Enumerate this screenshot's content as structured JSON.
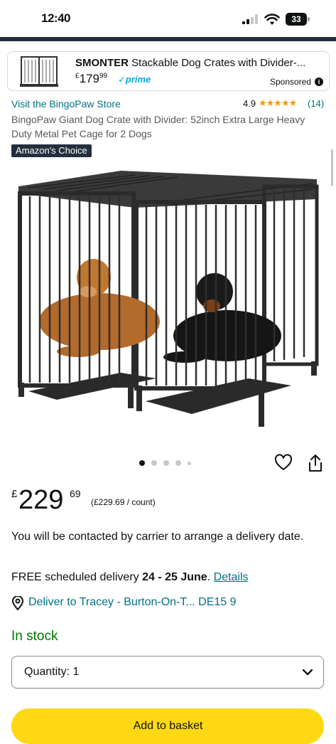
{
  "status_bar": {
    "time": "12:40",
    "battery": "33"
  },
  "sponsored": {
    "brand": "SMONTER",
    "title": " Stackable Dog Crates with Divider-...",
    "price_currency": "£",
    "price_whole": "179",
    "price_fraction": "99",
    "prime": "✓prime",
    "label": "Sponsored"
  },
  "product": {
    "store_link": "Visit the BingoPaw Store",
    "rating": "4.9",
    "stars": "★★★★★",
    "review_count": "(14)",
    "title": "BingoPaw Giant Dog Crate with Divider: 52inch Extra Large Heavy Duty Metal Pet Cage for 2 Dogs",
    "badge": "Amazon's Choice"
  },
  "carousel": {
    "count": 5,
    "active_index": 0
  },
  "price": {
    "currency": "£",
    "whole": "229",
    "fraction": "69",
    "unit_price": "(£229.69 / count)"
  },
  "delivery": {
    "contact_note": "You will be contacted by carrier to arrange a delivery date.",
    "prefix": "FREE scheduled delivery ",
    "dates": "24 - 25 June",
    "suffix": ". ",
    "details_link": "Details",
    "deliver_to": "Deliver to Tracey - Burton-On-T... DE15 9"
  },
  "stock": "In stock",
  "quantity": {
    "label": "Quantity: 1"
  },
  "add_to_basket": "Add to basket",
  "colors": {
    "link": "#007185",
    "stock": "#007600",
    "button": "#ffd814",
    "header": "#232f3e",
    "star": "#f69b00"
  },
  "icons": [
    "signal-icon",
    "wifi-icon",
    "battery-icon",
    "info-icon",
    "heart-icon",
    "share-icon",
    "location-pin-icon",
    "chevron-down-icon"
  ]
}
